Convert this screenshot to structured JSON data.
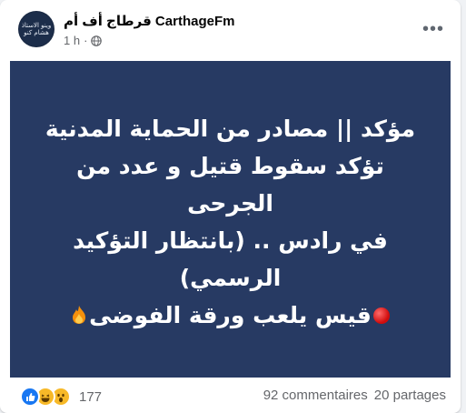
{
  "post": {
    "page_name": "قرطاج أف أم CarthageFm",
    "timestamp": "1 h",
    "separator": "·",
    "avatar_text": "وينو الاستاذ هشام كنو",
    "privacy_icon": "globe-icon",
    "more_icon": "more-horizontal-icon"
  },
  "image": {
    "background_color": "#273a63",
    "lines": [
      "مؤكد || مصادر من الحماية المدنية",
      "تؤكد سقوط قتيل و عدد من الجرحى",
      "في رادس .. (بانتظار التؤكيد",
      "الرسمي)",
      "قيس يلعب ورقة الفوضى"
    ],
    "emojis": [
      "red-circle-icon",
      "fire-icon"
    ]
  },
  "footer": {
    "reactions": [
      "like-icon",
      "haha-icon",
      "wow-icon"
    ],
    "reaction_count": "177",
    "comments": "92 commentaires",
    "shares": "20 partages"
  }
}
